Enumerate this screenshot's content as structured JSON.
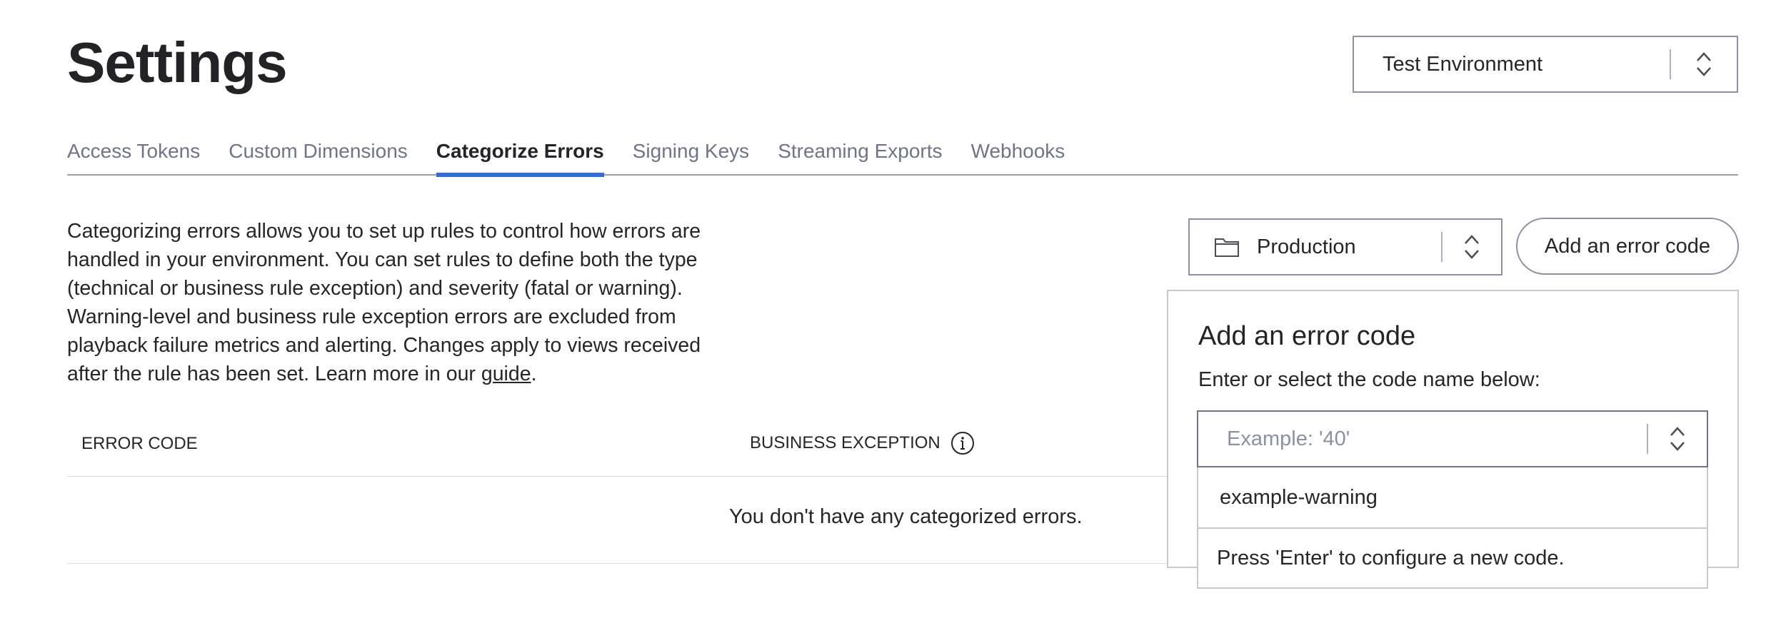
{
  "page": {
    "title": "Settings"
  },
  "environment_select": {
    "value": "Test Environment",
    "icon": "chevron-up-down-icon"
  },
  "tabs": [
    {
      "label": "Access Tokens",
      "active": false
    },
    {
      "label": "Custom Dimensions",
      "active": false
    },
    {
      "label": "Categorize Errors",
      "active": true
    },
    {
      "label": "Signing Keys",
      "active": false
    },
    {
      "label": "Streaming Exports",
      "active": false
    },
    {
      "label": "Webhooks",
      "active": false
    }
  ],
  "description": {
    "text": "Categorizing errors allows you to set up rules to control how errors are handled in your environment. You can set rules to define both the type (technical or business rule exception) and severity (fatal or warning). Warning-level and business rule exception errors are excluded from playback failure metrics and alerting. Changes apply to views received after the rule has been set. Learn more in our ",
    "link_text": "guide",
    "end": "."
  },
  "table": {
    "columns": [
      "ERROR CODE",
      "BUSINESS EXCEPTION"
    ],
    "empty_message": "You don't have any categorized errors."
  },
  "production_select": {
    "value": "Production",
    "icon": "folder-icon"
  },
  "add_button": {
    "label": "Add an error code"
  },
  "popover": {
    "title": "Add an error code",
    "label": "Enter or select the code name below:",
    "input_placeholder": "Example: '40'",
    "input_value": "",
    "options": [
      "example-warning"
    ],
    "hint": "Press 'Enter' to configure a new code."
  },
  "colors": {
    "accent": "#2e6ed6",
    "text": "#26262a",
    "muted": "#6f7488",
    "border": "#8c91a3"
  }
}
